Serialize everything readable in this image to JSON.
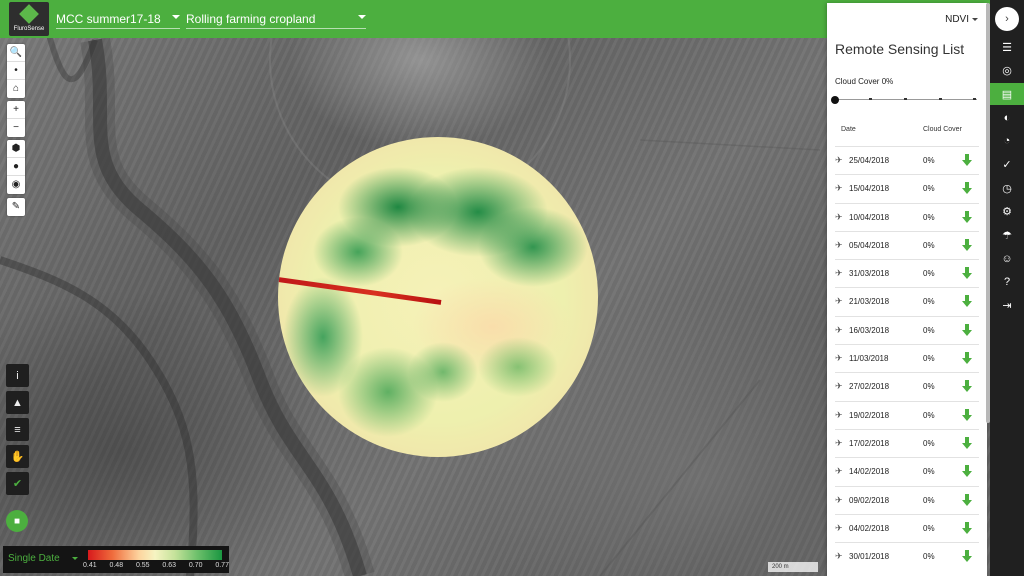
{
  "app": {
    "brand": "FluroSense"
  },
  "topbar": {
    "farm_select": "MCC summer17-18",
    "field_select": "Rolling farming cropland"
  },
  "map_tools": {
    "search": "🔍",
    "pin": "•",
    "home": "⌂",
    "zoom_in": "+",
    "zoom_out": "−",
    "polygon": "⬢",
    "circle": "●",
    "marker": "◉",
    "edit": "✎"
  },
  "side_tools": {
    "info": "i",
    "alert": "▲",
    "chart": "≡",
    "hand": "✋",
    "check": "✔",
    "chat": "■"
  },
  "legend": {
    "mode": "Single Date",
    "ticks": [
      "0.41",
      "0.48",
      "0.55",
      "0.63",
      "0.70",
      "0.77"
    ]
  },
  "scale": {
    "label": "200 m"
  },
  "panel": {
    "index": "NDVI",
    "title": "Remote Sensing List",
    "cloud_cover_label": "Cloud Cover 0%",
    "slider_value": 0,
    "col_date": "Date",
    "col_cloud": "Cloud Cover",
    "satellite_icon": "✈",
    "rows": [
      {
        "date": "25/04/2018",
        "cloud": "0%"
      },
      {
        "date": "15/04/2018",
        "cloud": "0%"
      },
      {
        "date": "10/04/2018",
        "cloud": "0%"
      },
      {
        "date": "05/04/2018",
        "cloud": "0%"
      },
      {
        "date": "31/03/2018",
        "cloud": "0%"
      },
      {
        "date": "21/03/2018",
        "cloud": "0%"
      },
      {
        "date": "16/03/2018",
        "cloud": "0%"
      },
      {
        "date": "11/03/2018",
        "cloud": "0%"
      },
      {
        "date": "27/02/2018",
        "cloud": "0%"
      },
      {
        "date": "19/02/2018",
        "cloud": "0%"
      },
      {
        "date": "17/02/2018",
        "cloud": "0%"
      },
      {
        "date": "14/02/2018",
        "cloud": "0%"
      },
      {
        "date": "09/02/2018",
        "cloud": "0%"
      },
      {
        "date": "04/02/2018",
        "cloud": "0%"
      },
      {
        "date": "30/01/2018",
        "cloud": "0%"
      }
    ]
  },
  "nav": {
    "collapse": "›",
    "items": [
      {
        "name": "layers-icon",
        "glyph": "☰",
        "active": false
      },
      {
        "name": "globe-icon",
        "glyph": "◎",
        "active": false
      },
      {
        "name": "remote-sensing-icon",
        "glyph": "▤",
        "active": true
      },
      {
        "name": "contrast-icon",
        "glyph": "◐",
        "active": false
      },
      {
        "name": "pie-icon",
        "glyph": "◔",
        "active": false
      },
      {
        "name": "check-circle-icon",
        "glyph": "✓",
        "active": false
      },
      {
        "name": "gauge-icon",
        "glyph": "◷",
        "active": false
      },
      {
        "name": "tractor-icon",
        "glyph": "⚙",
        "active": false
      },
      {
        "name": "weather-icon",
        "glyph": "☂",
        "active": false
      },
      {
        "name": "user-icon",
        "glyph": "☺",
        "active": false
      },
      {
        "name": "help-icon",
        "glyph": "?",
        "active": false
      },
      {
        "name": "logout-icon",
        "glyph": "⇥",
        "active": false
      }
    ]
  },
  "colors": {
    "brand": "#4caf3f",
    "dark": "#202020"
  }
}
